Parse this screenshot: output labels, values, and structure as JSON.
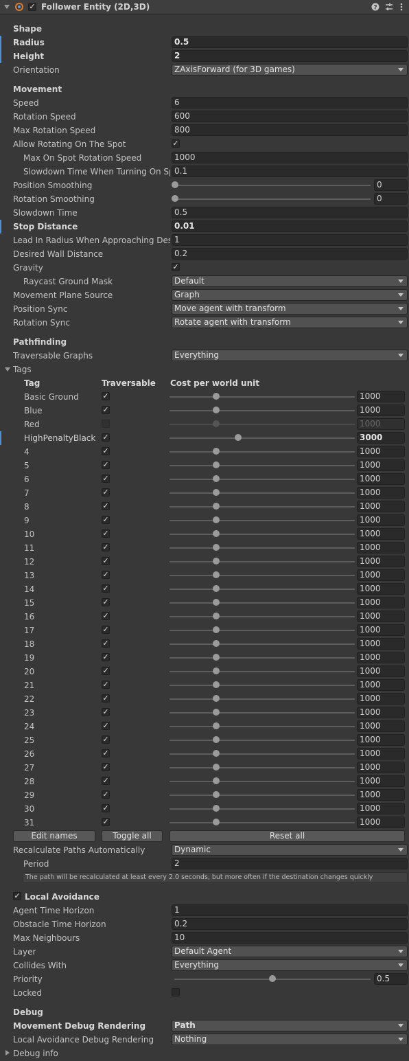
{
  "header": {
    "title": "Follower Entity (2D,3D)",
    "enabled": true
  },
  "shape": {
    "title": "Shape",
    "radius_label": "Radius",
    "radius": "0.5",
    "height_label": "Height",
    "height": "2",
    "orientation_label": "Orientation",
    "orientation": "ZAxisForward (for 3D games)"
  },
  "movement": {
    "title": "Movement",
    "speed_label": "Speed",
    "speed": "6",
    "rotation_speed_label": "Rotation Speed",
    "rotation_speed": "600",
    "max_rotation_speed_label": "Max Rotation Speed",
    "max_rotation_speed": "800",
    "allow_rotating_label": "Allow Rotating On The Spot",
    "max_on_spot_label": "Max On Spot Rotation Speed",
    "max_on_spot": "1000",
    "slowdown_turning_label": "Slowdown Time When Turning On Spo",
    "slowdown_turning": "0.1",
    "position_smoothing_label": "Position Smoothing",
    "position_smoothing": "0",
    "rotation_smoothing_label": "Rotation Smoothing",
    "rotation_smoothing": "0",
    "slowdown_time_label": "Slowdown Time",
    "slowdown_time": "0.5",
    "stop_distance_label": "Stop Distance",
    "stop_distance": "0.01",
    "lead_in_label": "Lead In Radius When Approaching Desti",
    "lead_in": "1",
    "wall_distance_label": "Desired Wall Distance",
    "wall_distance": "0.2",
    "gravity_label": "Gravity",
    "raycast_label": "Raycast Ground Mask",
    "raycast": "Default",
    "plane_label": "Movement Plane Source",
    "plane": "Graph",
    "position_sync_label": "Position Sync",
    "position_sync": "Move agent with transform",
    "rotation_sync_label": "Rotation Sync",
    "rotation_sync": "Rotate agent with transform"
  },
  "pathfinding": {
    "title": "Pathfinding",
    "graphs_label": "Traversable Graphs",
    "graphs": "Everything",
    "tags_label": "Tags",
    "col_tag": "Tag",
    "col_traversable": "Traversable",
    "col_cost": "Cost per world unit",
    "tags": [
      {
        "name": "Basic Ground",
        "traversable": true,
        "cost": "1000",
        "level": 0.25
      },
      {
        "name": "Blue",
        "traversable": true,
        "cost": "1000",
        "level": 0.25
      },
      {
        "name": "Red",
        "traversable": false,
        "cost": "1000",
        "level": 0.25
      },
      {
        "name": "HighPenaltyBlack",
        "traversable": true,
        "cost": "3000",
        "level": 0.37
      },
      {
        "name": "4",
        "traversable": true,
        "cost": "1000",
        "level": 0.25
      },
      {
        "name": "5",
        "traversable": true,
        "cost": "1000",
        "level": 0.25
      },
      {
        "name": "6",
        "traversable": true,
        "cost": "1000",
        "level": 0.25
      },
      {
        "name": "7",
        "traversable": true,
        "cost": "1000",
        "level": 0.25
      },
      {
        "name": "8",
        "traversable": true,
        "cost": "1000",
        "level": 0.25
      },
      {
        "name": "9",
        "traversable": true,
        "cost": "1000",
        "level": 0.25
      },
      {
        "name": "10",
        "traversable": true,
        "cost": "1000",
        "level": 0.25
      },
      {
        "name": "11",
        "traversable": true,
        "cost": "1000",
        "level": 0.25
      },
      {
        "name": "12",
        "traversable": true,
        "cost": "1000",
        "level": 0.25
      },
      {
        "name": "13",
        "traversable": true,
        "cost": "1000",
        "level": 0.25
      },
      {
        "name": "14",
        "traversable": true,
        "cost": "1000",
        "level": 0.25
      },
      {
        "name": "15",
        "traversable": true,
        "cost": "1000",
        "level": 0.25
      },
      {
        "name": "16",
        "traversable": true,
        "cost": "1000",
        "level": 0.25
      },
      {
        "name": "17",
        "traversable": true,
        "cost": "1000",
        "level": 0.25
      },
      {
        "name": "18",
        "traversable": true,
        "cost": "1000",
        "level": 0.25
      },
      {
        "name": "19",
        "traversable": true,
        "cost": "1000",
        "level": 0.25
      },
      {
        "name": "20",
        "traversable": true,
        "cost": "1000",
        "level": 0.25
      },
      {
        "name": "21",
        "traversable": true,
        "cost": "1000",
        "level": 0.25
      },
      {
        "name": "22",
        "traversable": true,
        "cost": "1000",
        "level": 0.25
      },
      {
        "name": "23",
        "traversable": true,
        "cost": "1000",
        "level": 0.25
      },
      {
        "name": "24",
        "traversable": true,
        "cost": "1000",
        "level": 0.25
      },
      {
        "name": "25",
        "traversable": true,
        "cost": "1000",
        "level": 0.25
      },
      {
        "name": "26",
        "traversable": true,
        "cost": "1000",
        "level": 0.25
      },
      {
        "name": "27",
        "traversable": true,
        "cost": "1000",
        "level": 0.25
      },
      {
        "name": "28",
        "traversable": true,
        "cost": "1000",
        "level": 0.25
      },
      {
        "name": "29",
        "traversable": true,
        "cost": "1000",
        "level": 0.25
      },
      {
        "name": "30",
        "traversable": true,
        "cost": "1000",
        "level": 0.25
      },
      {
        "name": "31",
        "traversable": true,
        "cost": "1000",
        "level": 0.25
      }
    ],
    "edit_names": "Edit names",
    "toggle_all": "Toggle all",
    "reset_all": "Reset all",
    "recalc_label": "Recalculate Paths Automatically",
    "recalc": "Dynamic",
    "period_label": "Period",
    "period": "2",
    "help": "The path will be recalculated at least every 2.0 seconds, but more often if the destination changes quickly"
  },
  "avoidance": {
    "title": "Local Avoidance",
    "agent_horizon_label": "Agent Time Horizon",
    "agent_horizon": "1",
    "obstacle_horizon_label": "Obstacle Time Horizon",
    "obstacle_horizon": "0.2",
    "max_neighbours_label": "Max Neighbours",
    "max_neighbours": "10",
    "layer_label": "Layer",
    "layer": "Default Agent",
    "collides_label": "Collides With",
    "collides": "Everything",
    "priority_label": "Priority",
    "priority": "0.5",
    "priority_level": 0.5,
    "locked_label": "Locked"
  },
  "debug": {
    "title": "Debug",
    "movement_label": "Movement Debug Rendering",
    "movement": "Path",
    "avoidance_label": "Local Avoidance Debug Rendering",
    "avoidance": "Nothing",
    "info_label": "Debug info"
  },
  "colors": {
    "background": "#383838",
    "accent": "#4c8fd6"
  }
}
